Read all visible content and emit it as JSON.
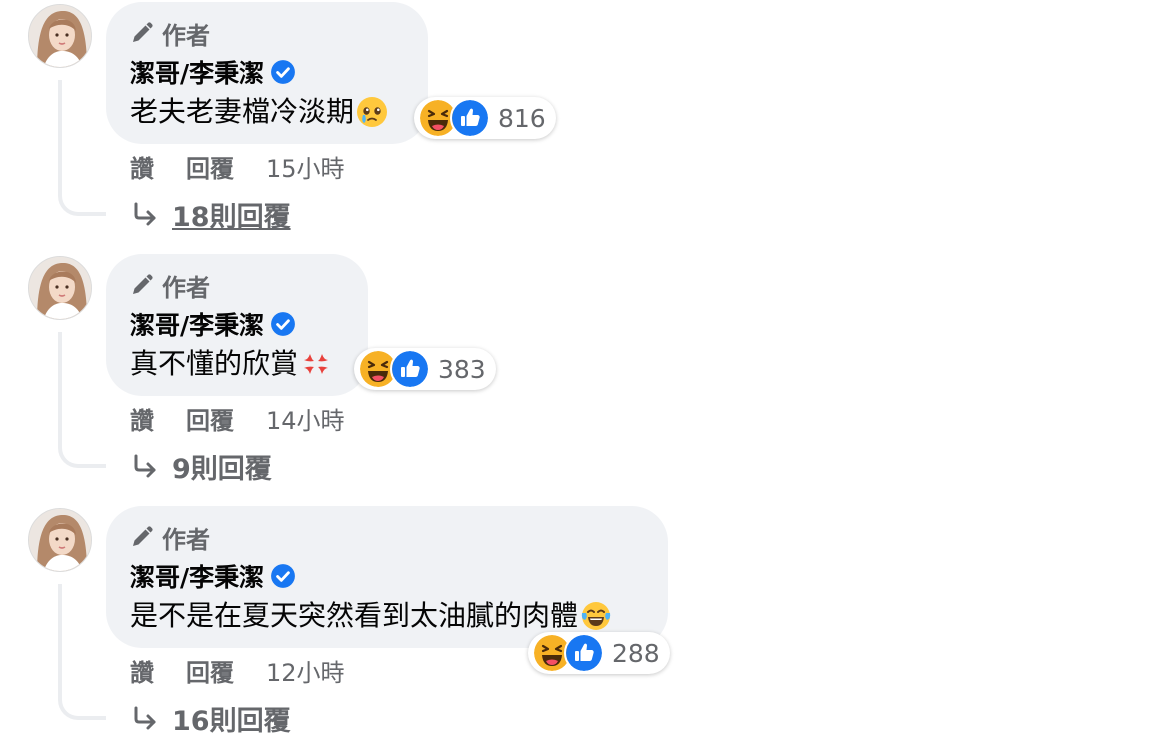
{
  "comments": [
    {
      "author_badge": "作者",
      "author_name": "潔哥/李秉潔",
      "text": "老夫老妻檔冷淡期",
      "text_emoji": "pleading-tear-emoji",
      "reaction_count": "816",
      "like_label": "讚",
      "reply_label": "回覆",
      "time": "15小時",
      "replies_label": "18則回覆"
    },
    {
      "author_badge": "作者",
      "author_name": "潔哥/李秉潔",
      "text": "真不懂的欣賞",
      "text_emoji": "anger-symbol-emoji",
      "reaction_count": "383",
      "like_label": "讚",
      "reply_label": "回覆",
      "time": "14小時",
      "replies_label": "9則回覆"
    },
    {
      "author_badge": "作者",
      "author_name": "潔哥/李秉潔",
      "text": "是不是在夏天突然看到太油膩的肉體",
      "text_emoji": "tears-of-joy-emoji",
      "reaction_count": "288",
      "like_label": "讚",
      "reply_label": "回覆",
      "time": "12小時",
      "replies_label": "16則回覆"
    }
  ],
  "colors": {
    "bubble_bg": "#f0f2f5",
    "secondary_text": "#65676b",
    "verified_blue": "#1877f2",
    "like_blue": "#1877f2",
    "haha_yellow": "#f7b125",
    "thread_line": "#ebedf0"
  },
  "icons": {
    "author_badge": "pen-icon",
    "verified": "verified-badge-icon",
    "reaction_1": "haha-reaction-icon",
    "reaction_2": "like-reaction-icon",
    "replies": "reply-arrow-icon"
  }
}
